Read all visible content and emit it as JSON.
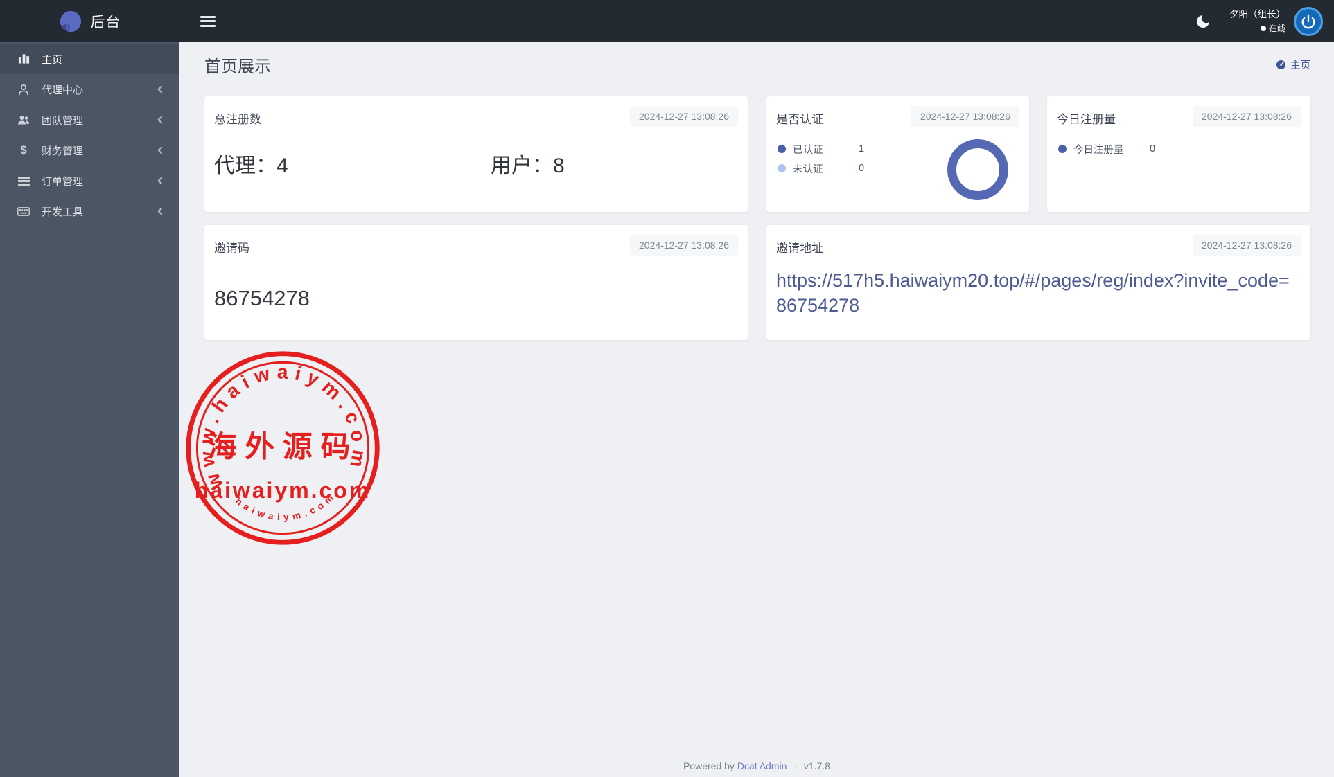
{
  "topbar": {
    "brand": "后台",
    "user_name": "夕阳（组长）",
    "user_status": "在线"
  },
  "sidebar": {
    "items": [
      {
        "label": "主页",
        "icon": "bar-chart-icon",
        "active": true,
        "has_children": false
      },
      {
        "label": "代理中心",
        "icon": "user-icon",
        "active": false,
        "has_children": true
      },
      {
        "label": "团队管理",
        "icon": "users-icon",
        "active": false,
        "has_children": true
      },
      {
        "label": "财务管理",
        "icon": "dollar-icon",
        "active": false,
        "has_children": true
      },
      {
        "label": "订单管理",
        "icon": "list-icon",
        "active": false,
        "has_children": true
      },
      {
        "label": "开发工具",
        "icon": "keyboard-icon",
        "active": false,
        "has_children": true
      }
    ]
  },
  "page": {
    "title": "首页展示",
    "breadcrumb": "主页"
  },
  "cards": {
    "total_registrations": {
      "title": "总注册数",
      "timestamp": "2024-12-27 13:08:26",
      "agents_label": "代理：",
      "agents_value": "4",
      "users_label": "用户：",
      "users_value": "8"
    },
    "verification": {
      "title": "是否认证",
      "timestamp": "2024-12-27 13:08:26",
      "legend": [
        {
          "label": "已认证",
          "value": "1",
          "color": "#4a5fa9"
        },
        {
          "label": "未认证",
          "value": "0",
          "color": "#a9c7ea"
        }
      ],
      "chart": {
        "type": "pie",
        "labels": [
          "已认证",
          "未认证"
        ],
        "values": [
          1,
          0
        ],
        "colors": [
          "#5468b4",
          "#a9c7ea"
        ],
        "legend_position": "left"
      }
    },
    "today_registrations": {
      "title": "今日注册量",
      "timestamp": "2024-12-27 13:08:26",
      "legend": [
        {
          "label": "今日注册量",
          "value": "0",
          "color": "#4a5fa9"
        }
      ]
    },
    "invite_code": {
      "title": "邀请码",
      "timestamp": "2024-12-27 13:08:26",
      "code": "86754278"
    },
    "invite_url": {
      "title": "邀请地址",
      "timestamp": "2024-12-27 13:08:26",
      "url": "https://517h5.haiwaiym20.top/#/pages/reg/index?invite_code=86754278"
    }
  },
  "watermark": {
    "arc_text_top": "www.haiwaiym.com",
    "center_text": "海外源码",
    "main_text": "haiwaiym.com",
    "arc_text_bottom": "haiwaiym.com",
    "color": "#e51e1e"
  },
  "footer": {
    "powered_by": "Powered by",
    "link": "Dcat Admin",
    "separator": "·",
    "version": "v1.7.8"
  },
  "colors": {
    "topbar_bg": "#232a32",
    "sidebar_bg": "#4c5564",
    "sidebar_active_bg": "#424b58",
    "content_bg": "#eef0f3",
    "accent_indigo": "#5468b4",
    "link_slate": "#4e5b92",
    "avatar_blue": "#1668b8",
    "stamp_red": "#e51e1e"
  },
  "icons": {
    "brand-logo-icon": "indigo sphere with swirl",
    "hamburger-icon": "three bars",
    "moon-icon": "crescent ☾",
    "power-icon": "⏻",
    "gauge-icon": "speedometer",
    "chevron-left-icon": "‹"
  }
}
